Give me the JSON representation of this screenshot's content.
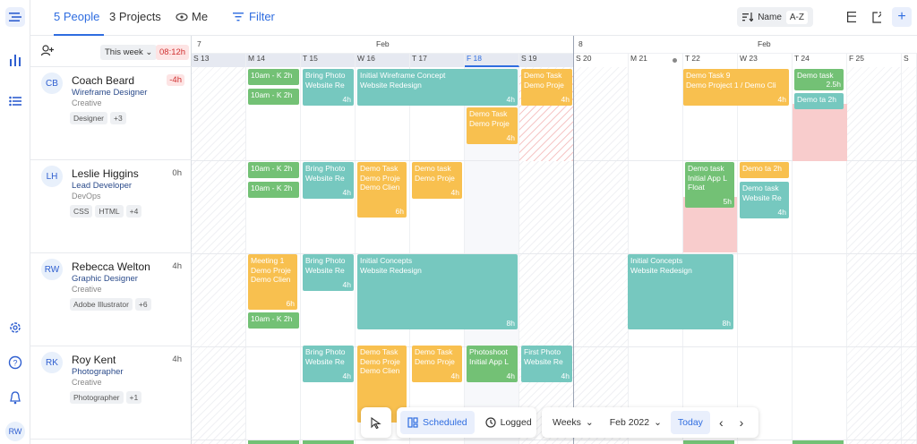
{
  "rail": {
    "user_initials": "RW"
  },
  "topbar": {
    "people_tab": "5 People",
    "projects_tab": "3 Projects",
    "me_tab": "Me",
    "filter_label": "Filter",
    "sort_name": "Name",
    "sort_order": "A-Z"
  },
  "left_header": {
    "range": "This week",
    "capacity": "08:12h"
  },
  "months": [
    {
      "day_number": "7",
      "name": "Feb"
    },
    {
      "day_number": "8",
      "name": "Feb"
    }
  ],
  "days": [
    "S 13",
    "M 14",
    "T 15",
    "W 16",
    "T 17",
    "F 18",
    "S 19",
    "S 20",
    "M 21",
    "T 22",
    "W 23",
    "T 24",
    "F 25",
    "S"
  ],
  "people": [
    {
      "initials": "CB",
      "name": "Coach Beard",
      "role": "Wireframe Designer",
      "dept": "Creative",
      "tags": [
        "Designer",
        "+3"
      ],
      "hours": "-4h"
    },
    {
      "initials": "LH",
      "name": "Leslie Higgins",
      "role": "Lead Developer",
      "dept": "DevOps",
      "tags": [
        "CSS",
        "HTML",
        "+4"
      ],
      "hours": "0h"
    },
    {
      "initials": "RW",
      "name": "Rebecca Welton",
      "role": "Graphic Designer",
      "dept": "Creative",
      "tags": [
        "Adobe Illustrator",
        "+6"
      ],
      "hours": "4h"
    },
    {
      "initials": "RK",
      "name": "Roy Kent",
      "role": "Photographer",
      "dept": "Creative",
      "tags": [
        "Photographer",
        "+1"
      ],
      "hours": "4h"
    }
  ],
  "tasks": {
    "cb1": {
      "l1": "10am - K 2h"
    },
    "cb2": {
      "l1": "10am - K 2h"
    },
    "cb3": {
      "l1": "Bring Photo",
      "l2": "Website Re",
      "h": "4h"
    },
    "cb4": {
      "l1": "Initial Wireframe Concept",
      "l2": "Website Redesign",
      "h": "4h"
    },
    "cb5": {
      "l1": "Demo Task",
      "l2": "Demo Proje",
      "h": "4h"
    },
    "cb6": {
      "l1": "Demo Task",
      "l2": "Demo Proje",
      "h": "4h"
    },
    "cb7": {
      "l1": "Demo Task 9",
      "l2": "Demo Project 1 / Demo Cli",
      "h": "4h"
    },
    "cb8": {
      "l1": "Demo task",
      "h": "2.5h"
    },
    "cb9": {
      "l1": "Demo ta 2h"
    },
    "lh1": {
      "l1": "10am - K 2h"
    },
    "lh2": {
      "l1": "10am - K 2h"
    },
    "lh3": {
      "l1": "Bring Photo",
      "l2": "Website Re",
      "h": "4h"
    },
    "lh4": {
      "l1": "Demo Task",
      "l2": "Demo Proje",
      "l3": "Demo Clien",
      "h": "6h"
    },
    "lh5": {
      "l1": "Demo task",
      "l2": "Demo Proje",
      "h": "4h"
    },
    "lh6": {
      "l1": "Demo task",
      "l2": "Initial App L",
      "l3": "Float",
      "h": "5h"
    },
    "lh7": {
      "l1": "Demo ta 2h"
    },
    "lh8": {
      "l1": "Demo task",
      "l2": "Website Re",
      "h": "4h"
    },
    "rw1": {
      "l1": "Meeting 1",
      "l2": "Demo Proje",
      "l3": "Demo Clien",
      "h": "6h"
    },
    "rw2": {
      "l1": "10am - K 2h"
    },
    "rw3": {
      "l1": "Bring Photo",
      "l2": "Website Re",
      "h": "4h"
    },
    "rw4": {
      "l1": "Initial Concepts",
      "l2": "Website Redesign",
      "h": "8h"
    },
    "rw5": {
      "l1": "Initial Concepts",
      "l2": "Website Redesign",
      "h": "8h"
    },
    "rk1": {
      "l1": "Bring Photo",
      "l2": "Website Re",
      "h": "4h"
    },
    "rk2": {
      "l1": "Demo Task",
      "l2": "Demo Proje",
      "l3": "Demo Clien"
    },
    "rk3": {
      "l1": "Demo Task",
      "l2": "Demo Proje",
      "h": "4h"
    },
    "rk4": {
      "l1": "Photoshoot",
      "l2": "Initial App L",
      "h": "4h"
    },
    "rk5": {
      "l1": "First Photo",
      "l2": "Website Re",
      "h": "4h"
    }
  },
  "bottombar": {
    "scheduled": "Scheduled",
    "logged": "Logged",
    "view": "Weeks",
    "month": "Feb 2022",
    "today": "Today"
  }
}
